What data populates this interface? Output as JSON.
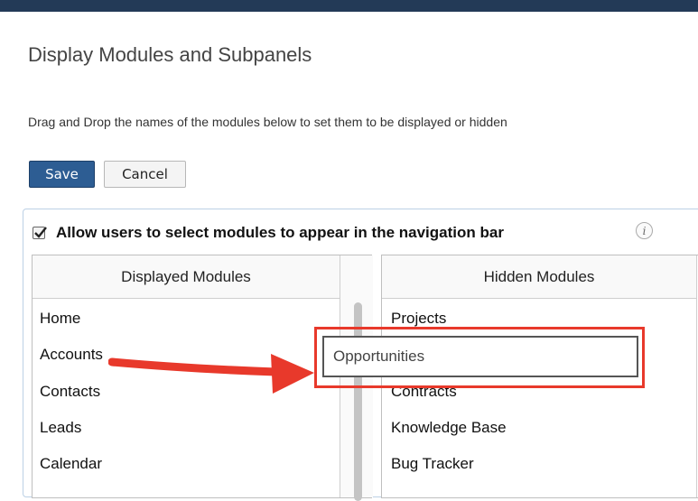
{
  "page": {
    "title": "Display Modules and Subpanels",
    "instructions": "Drag and Drop the names of the modules below to set them to be displayed or hidden"
  },
  "buttons": {
    "save": "Save",
    "cancel": "Cancel"
  },
  "allow": {
    "label": "Allow users to select modules to appear in the navigation bar",
    "checked": true,
    "info_icon": "i"
  },
  "displayed": {
    "header": "Displayed Modules",
    "items": [
      "Home",
      "Accounts",
      "Contacts",
      "Leads",
      "Calendar"
    ]
  },
  "hidden": {
    "header": "Hidden Modules",
    "items": [
      "Projects",
      "Contracts",
      "Knowledge Base",
      "Bug Tracker"
    ]
  },
  "dragging": {
    "label": "Opportunities"
  },
  "colors": {
    "accent": "#2d5d93",
    "highlight": "#e8392b"
  }
}
